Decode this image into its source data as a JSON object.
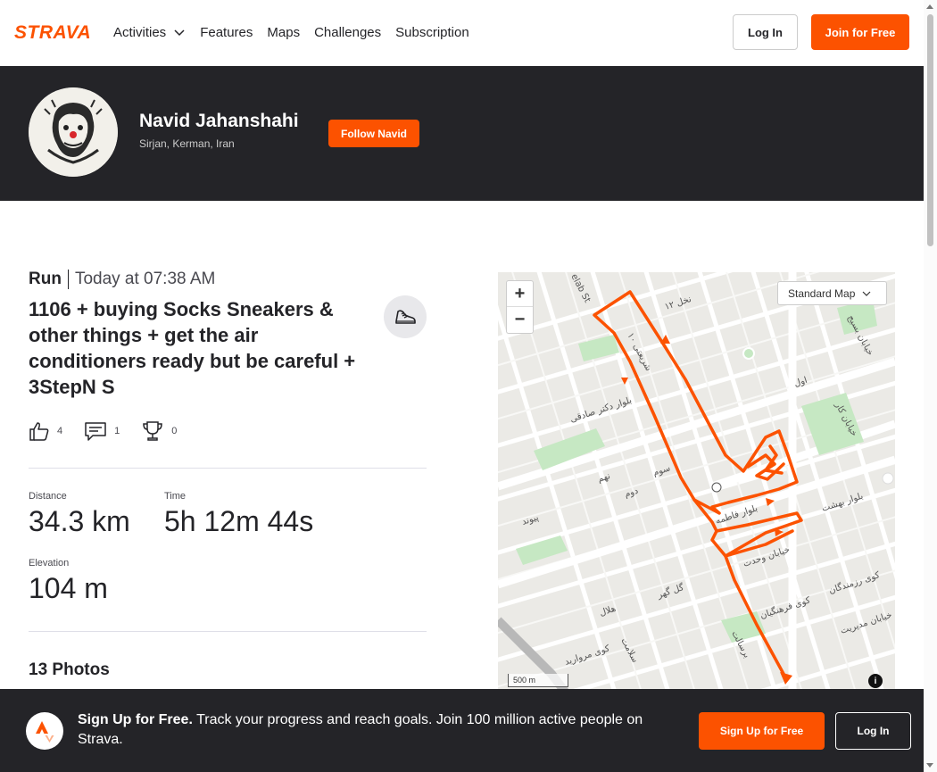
{
  "nav": {
    "logo_text": "STRAVA",
    "items": [
      {
        "label": "Activities"
      },
      {
        "label": "Features"
      },
      {
        "label": "Maps"
      },
      {
        "label": "Challenges"
      },
      {
        "label": "Subscription"
      }
    ],
    "login_label": "Log In",
    "join_label": "Join for Free"
  },
  "athlete": {
    "name": "Navid Jahanshahi",
    "location": "Sirjan, Kerman, Iran",
    "follow_label": "Follow Navid"
  },
  "activity": {
    "type": "Run",
    "date": "Today at 07:38 AM",
    "title": "1106 + buying Socks Sneakers & other things + get the air conditioners ready but be careful + 3StepN S",
    "kudos_count": "4",
    "comment_count": "1",
    "achievement_count": "0",
    "stats": {
      "distance_label": "Distance",
      "distance_value": "34.3 km",
      "time_label": "Time",
      "time_value": "5h 12m 44s",
      "elevation_label": "Elevation",
      "elevation_value": "104 m"
    },
    "photos_title": "13 Photos"
  },
  "map": {
    "style_label": "Standard Map",
    "scale_label": "500 m",
    "zoom_in": "+",
    "zoom_out": "−",
    "info": "i",
    "street_labels": [
      "ﻧﺨﻞ ۱۲",
      "ﺷﺮﯾﻌﺘﯽ ۱۰",
      "ﺑﻠﻮار دﮐﺘﺮ ﺻﺎدﻗﯽ",
      "ﺧﯿﺎﺑﺎن ﻛﺎر",
      "ﺑﻠﻮار ﺑﻬﺸﺖ",
      "ﺑﻠﻮار ﻓﺎﻃﻤﻪ",
      "ﺧﯿﺎﺑﺎن وﺣﺪت",
      "ﻛﻮی رزﻣﻨﺪﮔﺎن",
      "ﻛﻮی ﻓﺮﻫﻨﮕﯿﺎن",
      "ﻛﻮی ﻣﺮوارﯾﺪ",
      "ﺧﯿﺎﺑﺎن ﻣﺪﯾﺮﯾﺖ",
      "ﮔﻞ ﮔﻬﺮ",
      "ﺳﻮم",
      "دوم",
      "ﻧﻬﻢ",
      "ﭘﯿﻮﻧﺪ",
      "ﻫﻼل",
      "اول",
      "ﺧﯿﺎﺑﺎن ﺑﺴﯿﺞ",
      "ﺑﺮﺳﺎﻟﺖ",
      "ﺳﻼﻣﺖ",
      "elab St"
    ],
    "route_color": "#fc5200"
  },
  "banner": {
    "bold_text": "Sign Up for Free.",
    "text": " Track your progress and reach goals. Join 100 million active people on Strava.",
    "signup_label": "Sign Up for Free",
    "login_label": "Log In"
  },
  "colors": {
    "brand": "#fc5200",
    "dark": "#242428"
  }
}
